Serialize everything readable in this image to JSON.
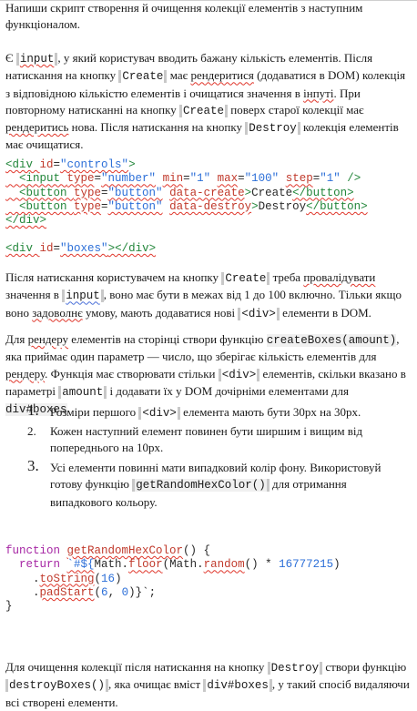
{
  "intro": "Напиши скрипт створення й очищення колекції елементів з наступним функціоналом.",
  "p1": {
    "a": "Є ",
    "input_tag": "input",
    "b": ", у який користувач вводить бажану кількість елементів. Після натискання на кнопку ",
    "create1": "Create",
    "c": " має ",
    "render1": "рендеритися",
    "d": " (додаватися в DOM) колекція з відповідною кількістю елементів і очищатися значення в ",
    "inputi": "інпуті",
    "e": ". При повторному натисканні на кнопку ",
    "create2": "Create",
    "f": " поверх старої колекції має ",
    "render2": "рендеритись",
    "g": " нова. Після натискання на кнопку ",
    "destroy1": "Destroy",
    "h": " колекція елементів має очищатися."
  },
  "code1": {
    "l1": {
      "open": "<div ",
      "attr": "id",
      "eq": "=",
      "val": "\"controls\"",
      "close": ">"
    },
    "l2": {
      "open": "  <input ",
      "a1": "type",
      "v1": "\"number\"",
      "a2": "min",
      "v2": "\"1\"",
      "a3": "max",
      "v3": "\"100\"",
      "a4": "step",
      "v4": "\"1\"",
      "close": " />"
    },
    "l3": {
      "open": "  <button ",
      "a1": "type",
      "v1": "\"button\"",
      "a2": "data-create",
      "text": "Create",
      "end": "</button>"
    },
    "l4": {
      "open": "  <button ",
      "a1": "type",
      "v1": "\"button\"",
      "a2": "data-destroy",
      "text": "Destroy",
      "end": "</button>"
    },
    "l5": "</div>",
    "l6": {
      "open": "<div ",
      "attr": "id",
      "val": "\"boxes\"",
      "end": "></div>"
    }
  },
  "p2": {
    "a": "Після натискання користувачем на кнопку ",
    "create": "Create",
    "b": " треба ",
    "validate": "провалідувати",
    "c": " значення в ",
    "input": "input",
    "d": ", воно має бути в межах від 1 до 100 включно. Тільки якщо воно ",
    "satisfies": "задоволнє",
    "e": " умову, мають додаватися нові ",
    "div": "<div>",
    "f": " елементи в DOM."
  },
  "p3": {
    "a": "Для ",
    "render": "рендеру",
    "b": " елементів на сторінці створи функцію ",
    "fn": "createBoxes(amount)",
    "c": ", яка приймає один параметр — число, що зберігає кількість елементів для ",
    "render2": "рендеру",
    "d": ". Функція має створювати стільки ",
    "div": "<div>",
    "e": " елементів, скільки вказано в параметрі ",
    "amount": "amount",
    "f": " і додавати їх у DOM дочірніми елементами для ",
    "sel": "div#boxes",
    "g": "."
  },
  "list": [
    {
      "n": "1.",
      "big": true,
      "a": "Розміри першого ",
      "code": "<div>",
      "b": " елемента мають бути 30px на 30px."
    },
    {
      "n": "2.",
      "big": false,
      "a": "Кожен наступний елемент повинен бути ширшим і вищим від попереднього на 10px.",
      "code": "",
      "b": ""
    },
    {
      "n": "3.",
      "big": true,
      "a": "Усі елементи повинні мати випадковий колір фону. Використовуй готову функцію ",
      "code": "getRandomHexColor()",
      "b": " для отримання випадкового кольору."
    }
  ],
  "code2": {
    "l1a": "function ",
    "l1b": "getRandomHexColor",
    "l1c": "() {",
    "l2a": "  return ",
    "l2b": "`#${",
    "l2c": "Math",
    "l2d": ".",
    "l2e": "floor",
    "l2f": "(",
    "l2g": "Math",
    "l2h": ".",
    "l2i": "random",
    "l2j": "() * ",
    "l2k": "16777215",
    "l2l": ")",
    "l3a": "    .",
    "l3b": "toString",
    "l3c": "(",
    "l3d": "16",
    "l3e": ")",
    "l4a": "    .",
    "l4b": "padStart",
    "l4c": "(",
    "l4d": "6",
    "l4e": ", ",
    "l4f": "0",
    "l4g": ")}`;",
    "l5": "}"
  },
  "p4": {
    "a": "Для очищення колекції після натискання на кнопку ",
    "destroy": "Destroy",
    "b": " створи функцію ",
    "fn": "destroyBoxes()",
    "c": ", яка очищає вміст ",
    "sel": "div#boxes",
    "d": ", у такий спосіб видаляючи всі створені елементи."
  }
}
